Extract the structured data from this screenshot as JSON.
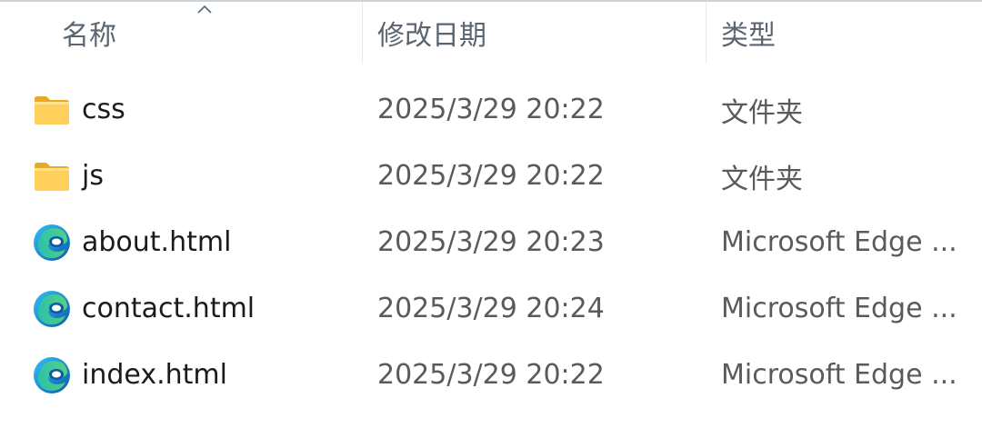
{
  "columns": {
    "name": "名称",
    "date": "修改日期",
    "type": "类型"
  },
  "files": [
    {
      "name": "css",
      "date": "2025/3/29 20:22",
      "type": "文件夹",
      "icon": "folder-icon"
    },
    {
      "name": "js",
      "date": "2025/3/29 20:22",
      "type": "文件夹",
      "icon": "folder-icon"
    },
    {
      "name": "about.html",
      "date": "2025/3/29 20:23",
      "type": "Microsoft Edge ...",
      "icon": "edge-icon"
    },
    {
      "name": "contact.html",
      "date": "2025/3/29 20:24",
      "type": "Microsoft Edge ...",
      "icon": "edge-icon"
    },
    {
      "name": "index.html",
      "date": "2025/3/29 20:22",
      "type": "Microsoft Edge ...",
      "icon": "edge-icon"
    }
  ],
  "colors": {
    "folder": "#f5c242",
    "folder_light": "#ffd96a",
    "edge_blue": "#0c59a4",
    "edge_teal": "#2fc2a8",
    "header_text": "#5a6570"
  }
}
